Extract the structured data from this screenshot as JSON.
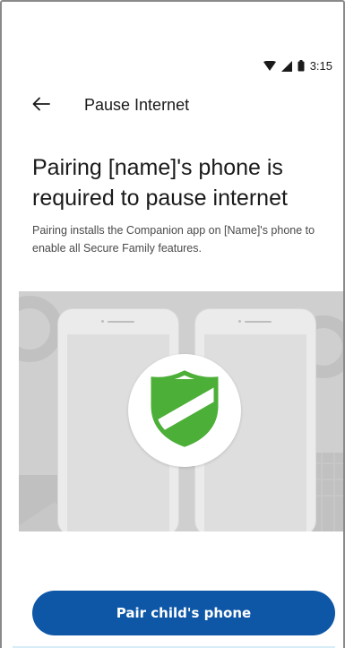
{
  "status_bar": {
    "time": "3:15",
    "icons": [
      "wifi-icon",
      "cell-signal-icon",
      "battery-icon"
    ]
  },
  "app_bar": {
    "back_icon": "arrow-left-icon",
    "title": "Pause Internet"
  },
  "content": {
    "headline": "Pairing [name]'s phone is required to pause internet",
    "description": "Pairing installs the Companion app on [Name]'s phone to enable all Secure Family features."
  },
  "hero": {
    "illustration": "two-phones-shield-illustration",
    "badge_icon": "shield-icon",
    "colors": {
      "background": "#cfcfcf",
      "shield_green": "#4caf37"
    }
  },
  "actions": {
    "primary_label": "Pair child's phone"
  },
  "theme": {
    "accent": "#0e57a6",
    "text_primary": "#1a1a1a",
    "text_secondary": "#4a4a4a"
  }
}
